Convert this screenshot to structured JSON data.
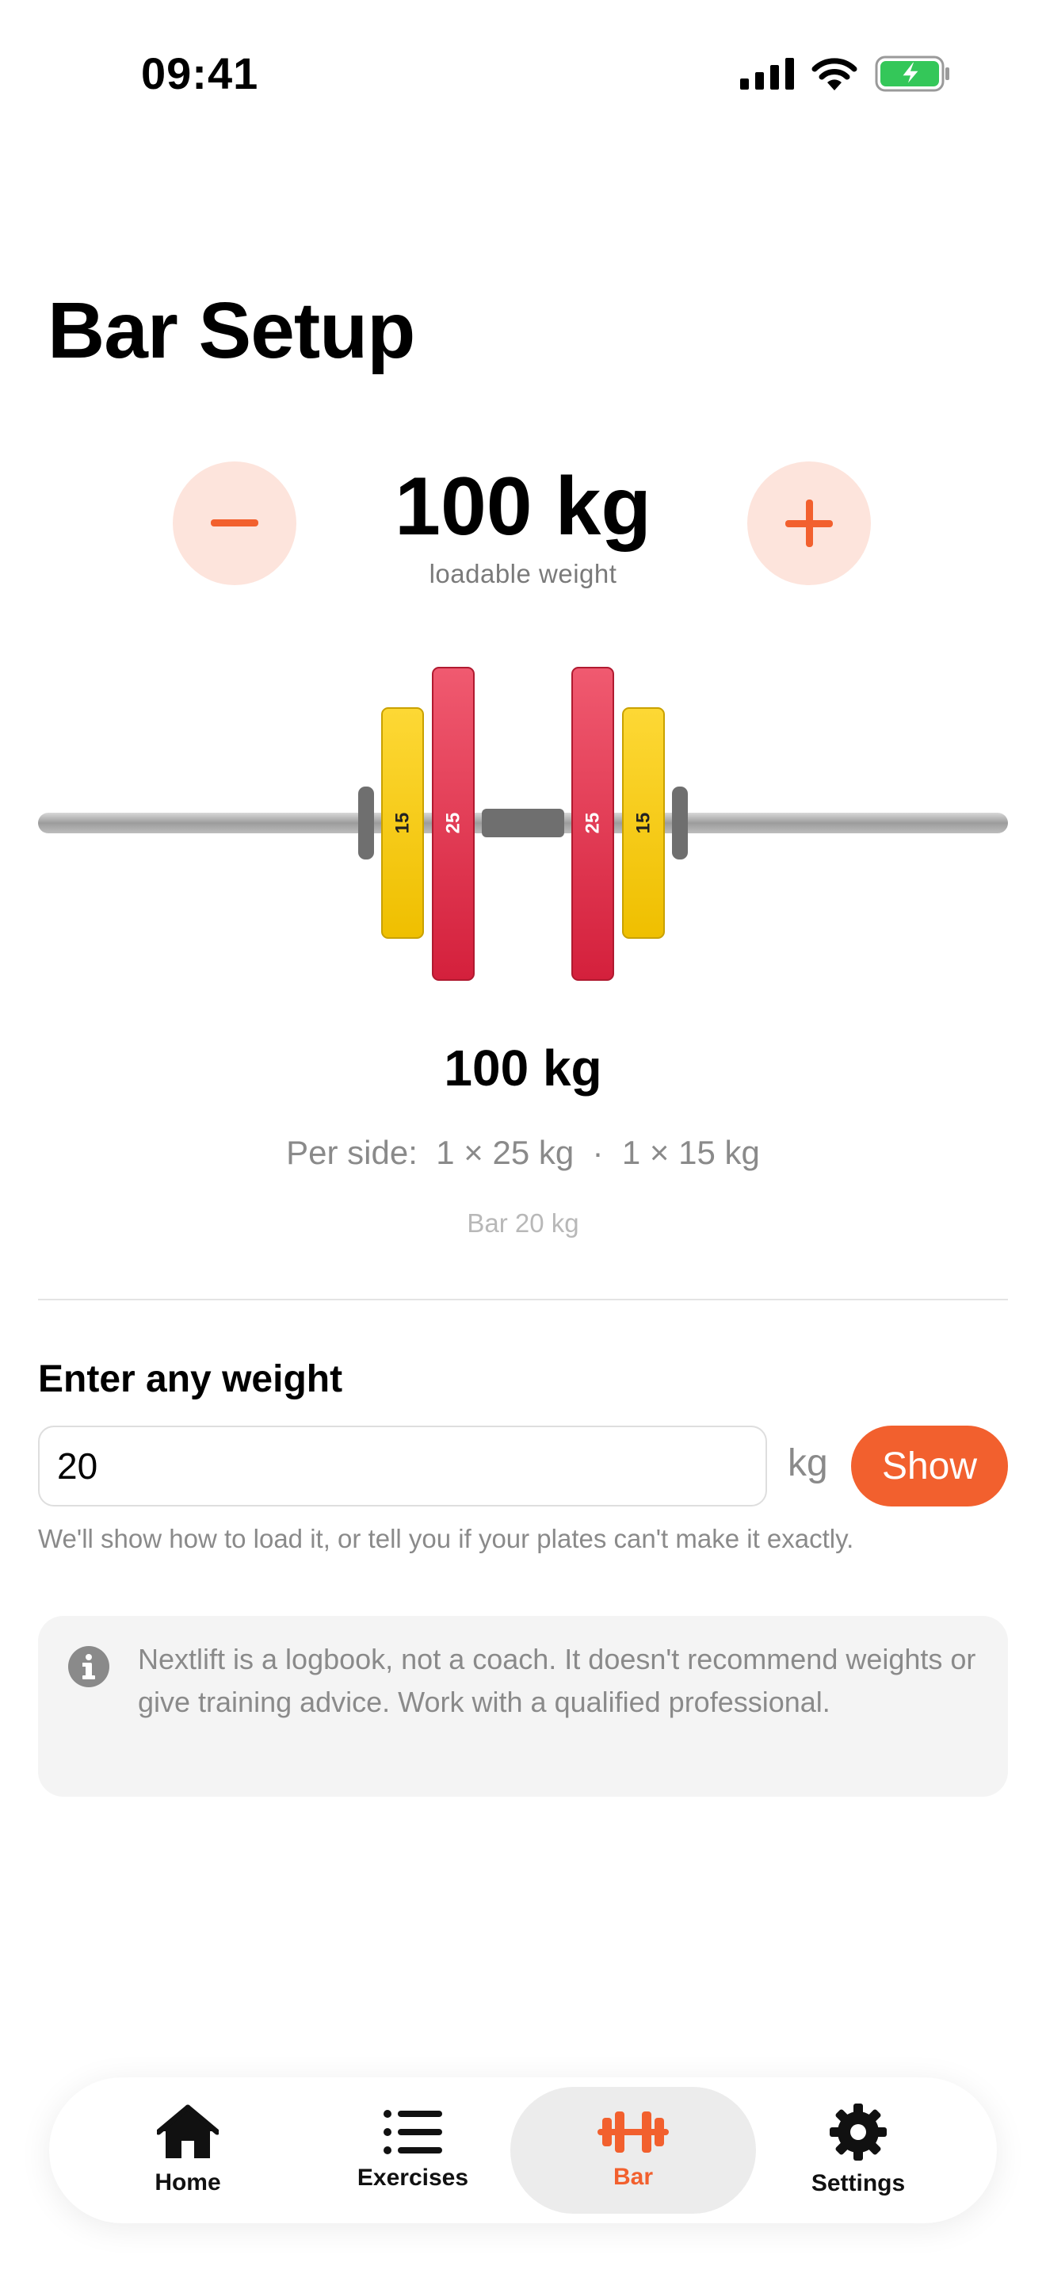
{
  "status_bar": {
    "time": "09:41"
  },
  "page": {
    "title": "Bar Setup"
  },
  "stepper": {
    "value": "100 kg",
    "caption": "loadable weight",
    "minus_icon": "minus-icon",
    "plus_icon": "plus-icon"
  },
  "barbell": {
    "plates_per_side": [
      "25",
      "15"
    ],
    "colors": {
      "plate_25": "#e0304a",
      "plate_15": "#f5c518",
      "bar": "#a8a8a8",
      "collar": "#6f6f6f"
    }
  },
  "summary": {
    "total": "100 kg",
    "per_side": "Per side:  1 × 25 kg  ·  1 × 15 kg",
    "bar": "Bar 20 kg"
  },
  "custom_weight": {
    "heading": "Enter any weight",
    "value": "20",
    "unit": "kg",
    "show_label": "Show",
    "help": "We'll show how to load it, or tell you if your plates can't make it exactly."
  },
  "disclaimer": {
    "icon": "info-icon",
    "text": "Nextlift is a logbook, not a coach. It doesn't recommend weights or give training advice. Work with a qualified professional."
  },
  "tabs": [
    {
      "label": "Home",
      "icon": "home-icon",
      "active": false
    },
    {
      "label": "Exercises",
      "icon": "list-icon",
      "active": false
    },
    {
      "label": "Bar",
      "icon": "barbell-icon",
      "active": true
    },
    {
      "label": "Settings",
      "icon": "gear-icon",
      "active": false
    }
  ],
  "colors": {
    "accent": "#f2602e",
    "accent_soft": "#fde4dc"
  }
}
